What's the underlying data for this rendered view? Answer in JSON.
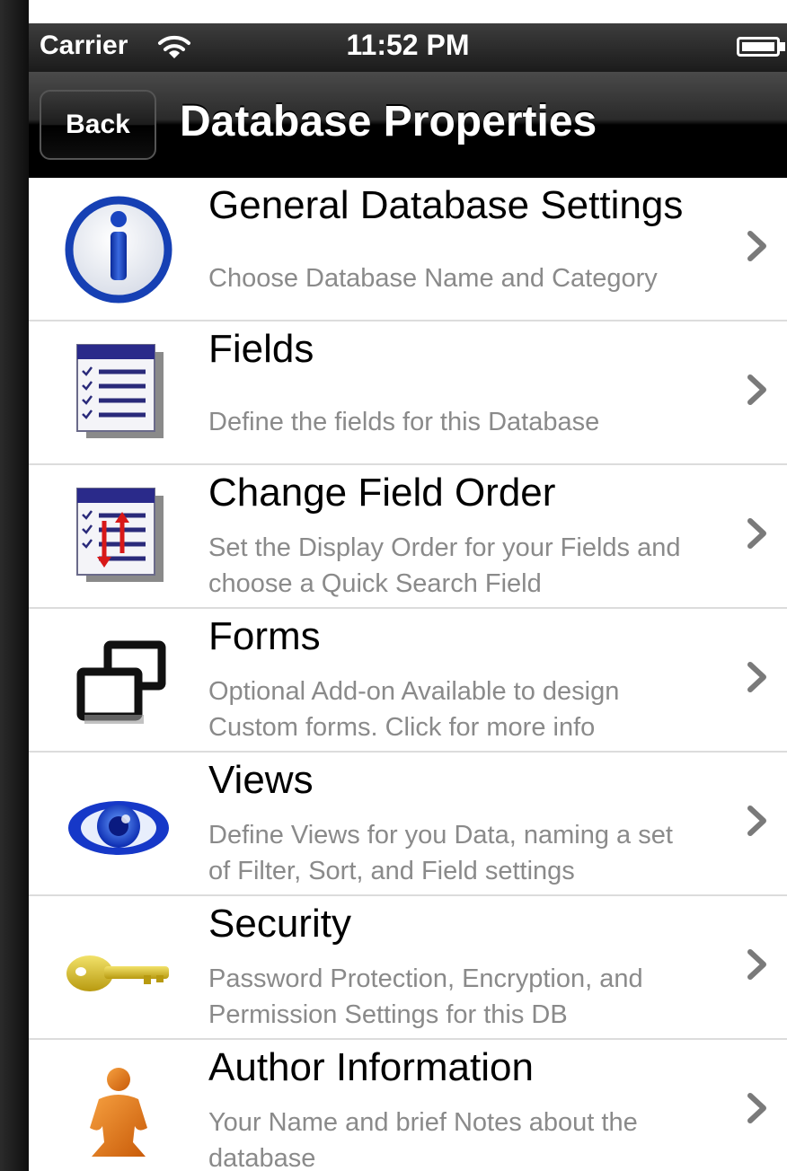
{
  "status_bar": {
    "carrier": "Carrier",
    "time": "11:52 PM"
  },
  "nav": {
    "back_label": "Back",
    "title": "Database Properties"
  },
  "rows": [
    {
      "title": "General Database Settings",
      "subtitle_lines": [
        "Choose Database Name and Category"
      ],
      "icon": "info-icon"
    },
    {
      "title": "Fields",
      "subtitle_lines": [
        "Define the fields for this Database"
      ],
      "icon": "fields-list-icon"
    },
    {
      "title": "Change Field Order",
      "subtitle_lines": [
        "Set the Display Order for your Fields and",
        "choose a Quick Search Field"
      ],
      "icon": "field-order-icon"
    },
    {
      "title": "Forms",
      "subtitle_lines": [
        "Optional Add-on Available to design",
        "Custom forms.  Click for more info"
      ],
      "icon": "forms-windows-icon"
    },
    {
      "title": "Views",
      "subtitle_lines": [
        "Define Views for you Data, naming a set",
        "of Filter, Sort, and Field settings"
      ],
      "icon": "eye-icon"
    },
    {
      "title": "Security",
      "subtitle_lines": [
        "Password Protection, Encryption, and",
        "Permission Settings for this DB"
      ],
      "icon": "key-icon"
    },
    {
      "title": "Author Information",
      "subtitle_lines": [
        "Your Name and brief Notes about the",
        "database"
      ],
      "icon": "person-icon"
    }
  ],
  "colors": {
    "nav_background": "#000000",
    "subtitle_text": "#8a8a8a",
    "separator": "#dcdcdc"
  }
}
